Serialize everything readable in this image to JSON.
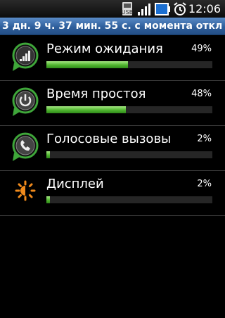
{
  "status_bar": {
    "time": "12:06",
    "icons": [
      "usb-debugging-icon",
      "signal-strength-icon",
      "battery-icon",
      "alarm-clock-icon"
    ]
  },
  "header": {
    "title": "3 дн. 9 ч. 37 мин. 55 с. с момента отключ..."
  },
  "usage_items": [
    {
      "label": "Режим ожидания",
      "percent_text": "49%",
      "percent": 49,
      "icon": "cell-standby-icon"
    },
    {
      "label": "Время простоя",
      "percent_text": "48%",
      "percent": 48,
      "icon": "power-idle-icon"
    },
    {
      "label": "Голосовые вызовы",
      "percent_text": "2%",
      "percent": 2,
      "icon": "phone-call-icon"
    },
    {
      "label": "Дисплей",
      "percent_text": "2%",
      "percent": 2,
      "icon": "display-brightness-icon"
    }
  ],
  "colors": {
    "title_bar": "#2f5f9c",
    "bar_fill": "#4fb52f",
    "bar_track": "#262626",
    "brightness_icon": "#f08a1c"
  }
}
